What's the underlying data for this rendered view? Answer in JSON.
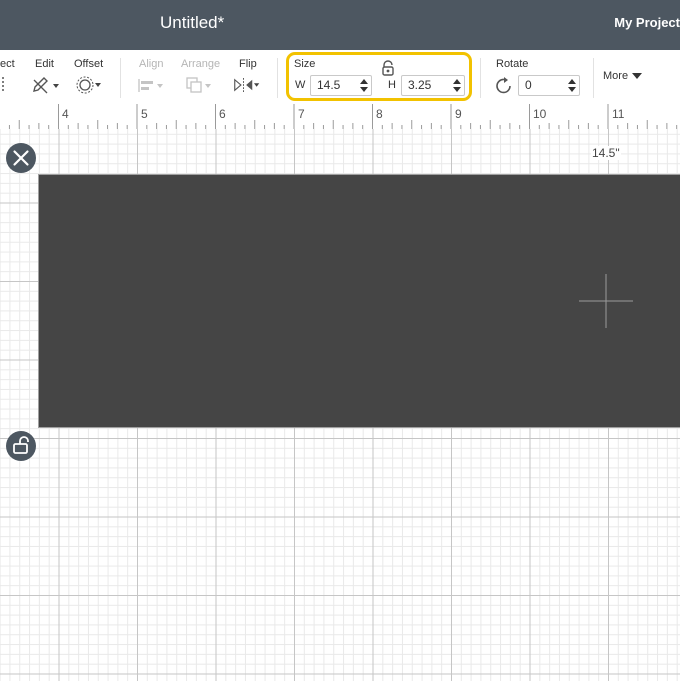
{
  "header": {
    "title": "Untitled*",
    "projects_label": "My Project"
  },
  "toolbar": {
    "select_label": "ect",
    "edit_label": "Edit",
    "offset_label": "Offset",
    "align_label": "Align",
    "arrange_label": "Arrange",
    "flip_label": "Flip",
    "size": {
      "label": "Size",
      "w_label": "W",
      "w_value": "14.5",
      "h_label": "H",
      "h_value": "3.25"
    },
    "rotate": {
      "label": "Rotate",
      "value": "0"
    },
    "more_label": "More"
  },
  "ruler": {
    "marks": [
      "4",
      "5",
      "6",
      "7",
      "8",
      "9",
      "10",
      "11"
    ]
  },
  "canvas": {
    "width_readout": "14.5\""
  },
  "colors": {
    "header": "#4d5761",
    "shape": "#454545",
    "highlight": "#f2c200"
  }
}
